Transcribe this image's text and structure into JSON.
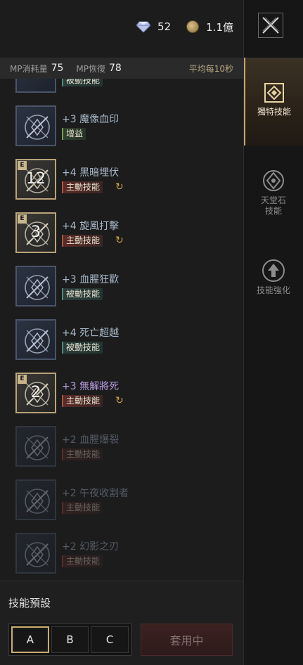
{
  "currency": {
    "gem": "52",
    "coin": "1.1億"
  },
  "mp": {
    "cost_label": "MP消耗量",
    "cost_value": "75",
    "regen_label": "MP恢復",
    "regen_value": "78",
    "avg_label": "平均每10秒"
  },
  "skills": [
    {
      "title": "+3 魔像血印",
      "tag": "增益",
      "tag_type": "buff",
      "icon": "golem-skull-icon",
      "style": "blue",
      "cycle": false,
      "num": ""
    },
    {
      "title": "+4 黑暗埋伏",
      "tag": "主動技能",
      "tag_type": "active",
      "icon": "dark-ambush-icon",
      "style": "gold",
      "cycle": true,
      "num": "12"
    },
    {
      "title": "+4 旋風打擊",
      "tag": "主動技能",
      "tag_type": "active",
      "icon": "whirlwind-icon",
      "style": "gold",
      "cycle": true,
      "num": "3"
    },
    {
      "title": "+3 血腥狂歡",
      "tag": "被動技能",
      "tag_type": "passive",
      "icon": "blood-frenzy-icon",
      "style": "blue",
      "cycle": false,
      "num": ""
    },
    {
      "title": "+4 死亡超越",
      "tag": "被動技能",
      "tag_type": "passive",
      "icon": "death-transcend-icon",
      "style": "blue",
      "cycle": false,
      "num": ""
    },
    {
      "title": "+3 無解將死",
      "tag": "主動技能",
      "tag_type": "active",
      "icon": "checkmate-icon",
      "style": "gold",
      "cycle": true,
      "num": "2",
      "purple": true
    },
    {
      "title": "+2 血腥爆裂",
      "tag": "主動技能",
      "tag_type": "active",
      "icon": "blood-burst-icon",
      "style": "dim",
      "cycle": false,
      "num": ""
    },
    {
      "title": "+2 午夜收割者",
      "tag": "主動技能",
      "tag_type": "active",
      "icon": "midnight-reaper-icon",
      "style": "dim",
      "cycle": false,
      "num": ""
    },
    {
      "title": "+2 幻影之刃",
      "tag": "主動技能",
      "tag_type": "active",
      "icon": "phantom-blade-icon",
      "style": "dim",
      "cycle": false,
      "num": ""
    }
  ],
  "partial_top_tag": "被動技能",
  "preset": {
    "title": "技能預設",
    "options": [
      "A",
      "B",
      "C"
    ],
    "selected": "A",
    "apply_label": "套用中"
  },
  "side": {
    "tabs": [
      {
        "label": "獨特技能",
        "icon": "unique-skill-icon",
        "active": true
      },
      {
        "label": "天堂石\n技能",
        "icon": "heaven-stone-icon",
        "active": false
      },
      {
        "label": "技能強化",
        "icon": "skill-enhance-icon",
        "active": false
      }
    ]
  }
}
